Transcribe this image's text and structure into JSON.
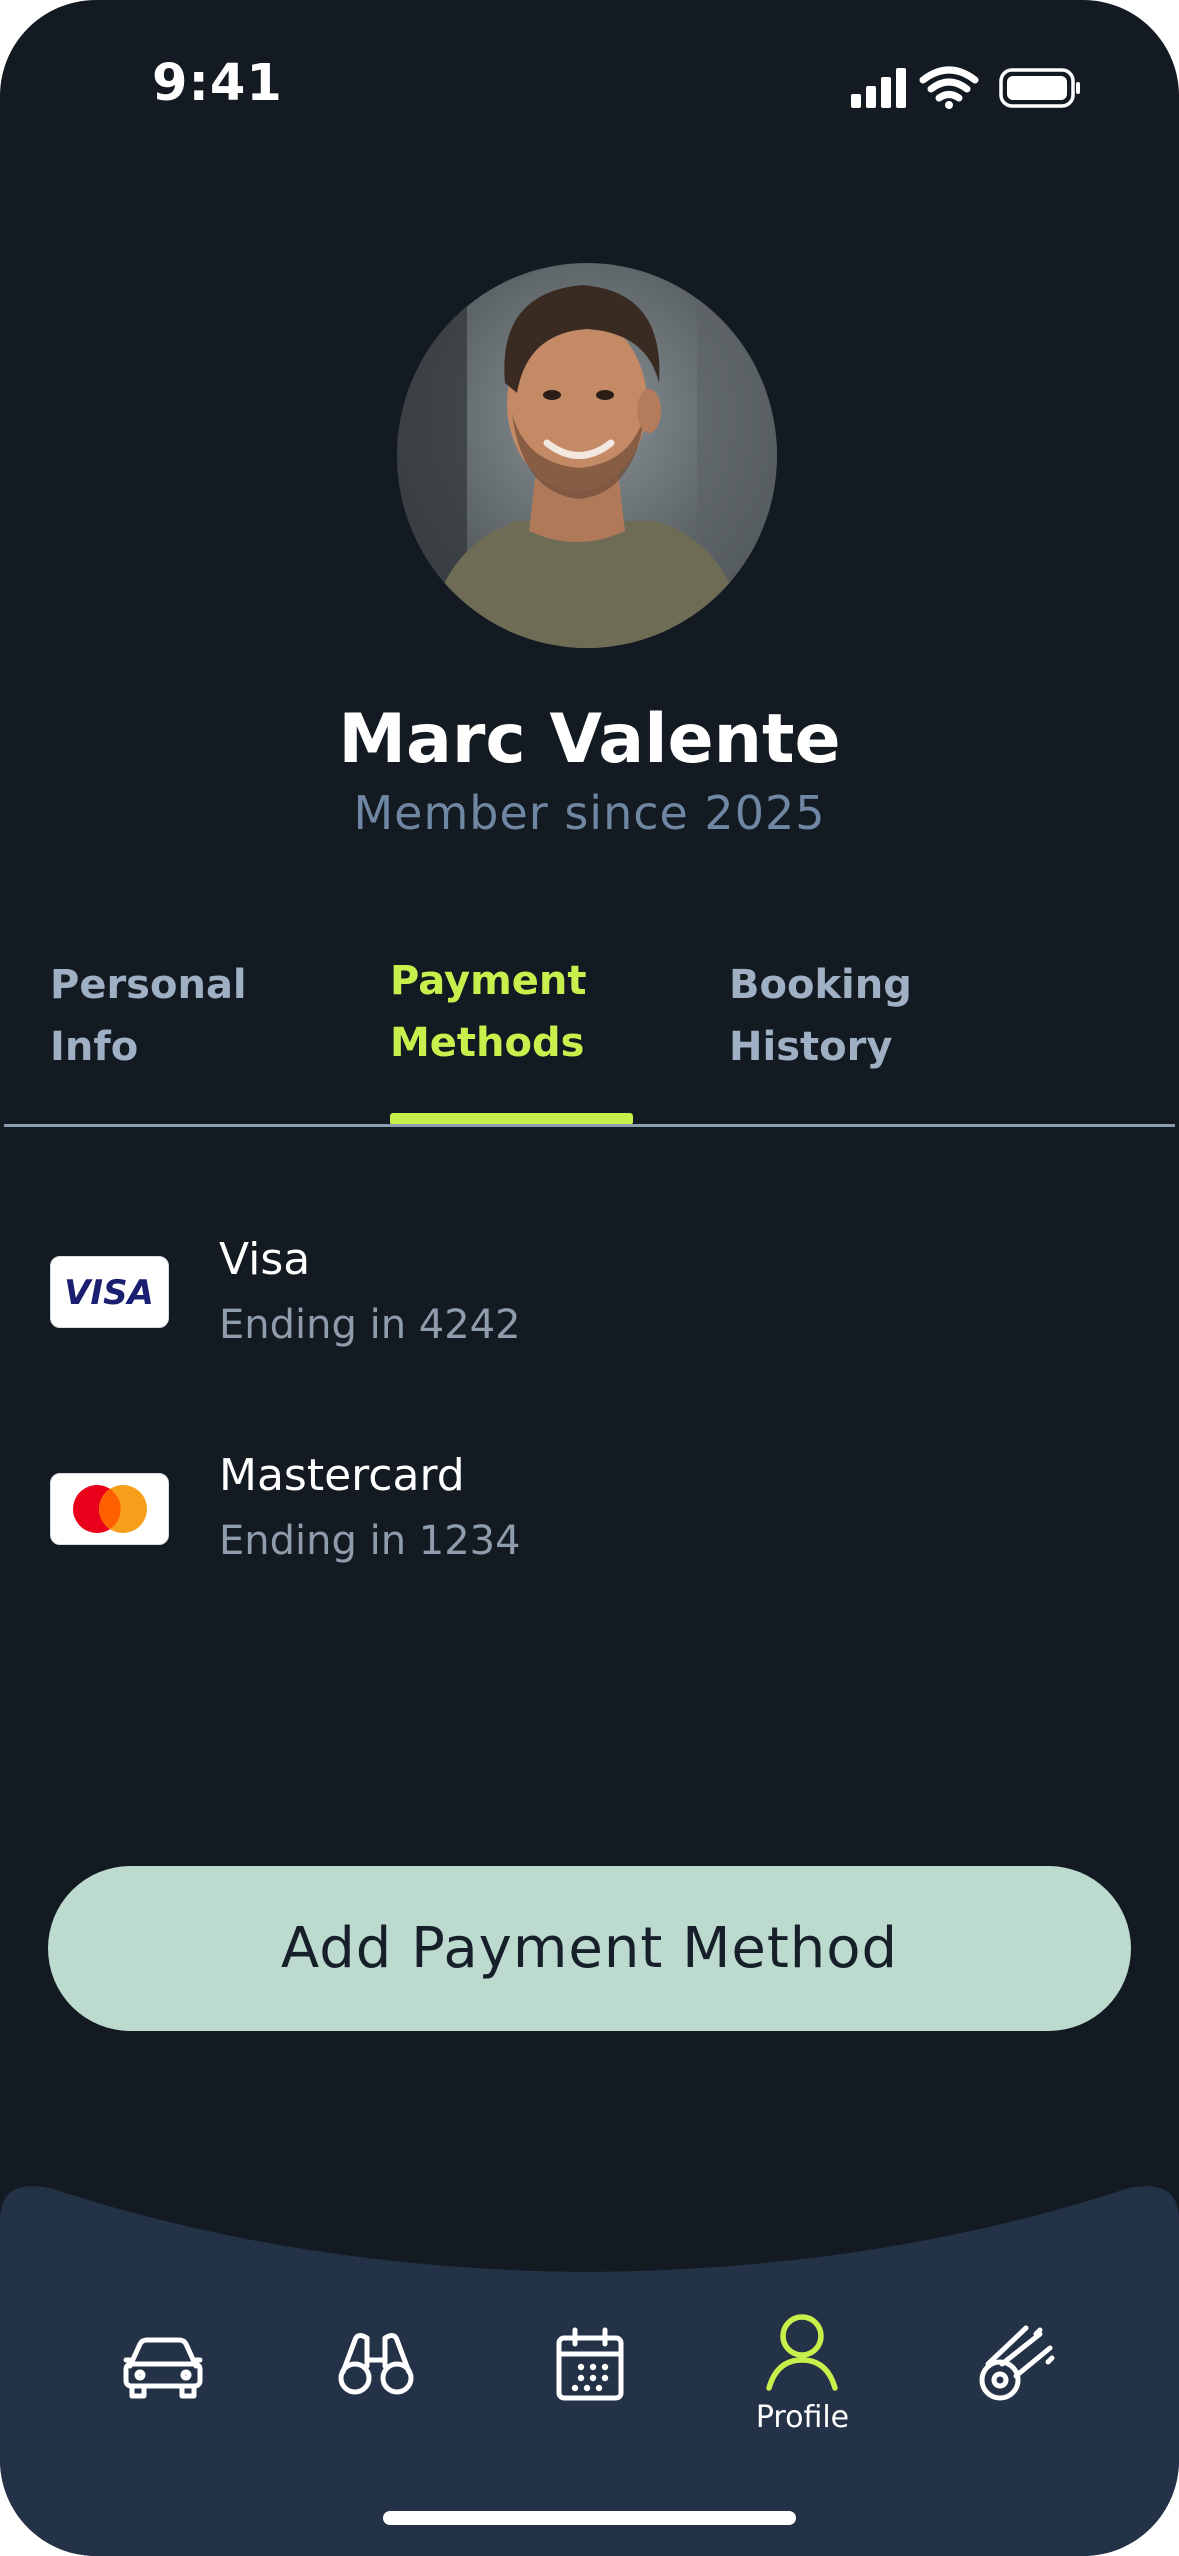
{
  "status_bar": {
    "time": "9:41"
  },
  "profile": {
    "name": "Marc Valente",
    "member_since": "Member since 2025"
  },
  "tabs": [
    {
      "line1": "Personal",
      "line2": "Info",
      "active": false
    },
    {
      "line1": "Payment",
      "line2": "Methods",
      "active": true
    },
    {
      "line1": "Booking",
      "line2": "History",
      "active": false
    }
  ],
  "payment_methods": [
    {
      "brand_mark": "VISA",
      "name": "Visa",
      "detail": "Ending in 4242",
      "icon": "visa-logo"
    },
    {
      "name": "Mastercard",
      "detail": "Ending in 1234",
      "icon": "mastercard-logo"
    }
  ],
  "add_button": {
    "label": "Add Payment Method"
  },
  "bottom_nav": {
    "items": [
      {
        "icon": "car-icon",
        "label": ""
      },
      {
        "icon": "binoculars-icon",
        "label": ""
      },
      {
        "icon": "calendar-icon",
        "label": ""
      },
      {
        "icon": "profile-icon",
        "label": "Profile",
        "active": true
      },
      {
        "icon": "meteor-icon",
        "label": ""
      }
    ]
  },
  "colors": {
    "background": "#131a21",
    "accent": "#c8f04c",
    "button": "#bcdace",
    "nav_background": "#243247",
    "muted_text": "#6f87a3"
  }
}
